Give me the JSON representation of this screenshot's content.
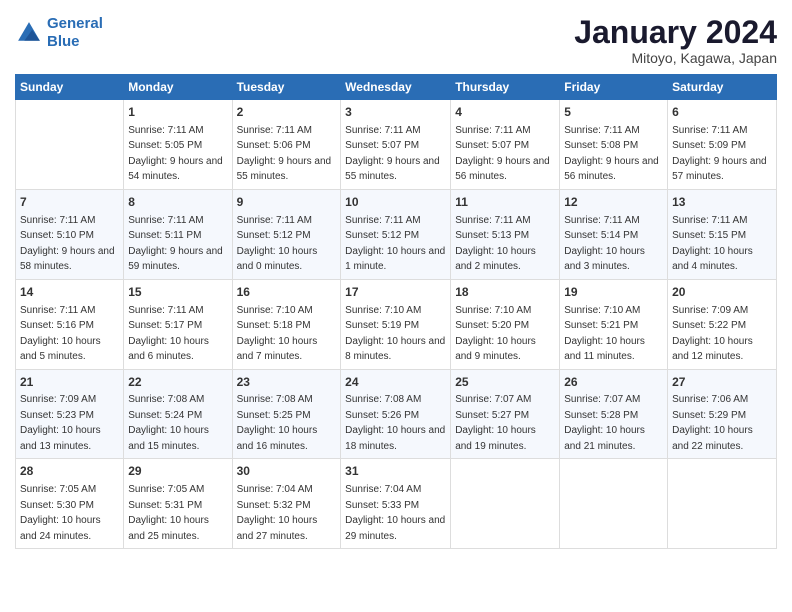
{
  "logo": {
    "line1": "General",
    "line2": "Blue"
  },
  "title": "January 2024",
  "location": "Mitoyo, Kagawa, Japan",
  "weekdays": [
    "Sunday",
    "Monday",
    "Tuesday",
    "Wednesday",
    "Thursday",
    "Friday",
    "Saturday"
  ],
  "weeks": [
    [
      {
        "day": "",
        "sunrise": "",
        "sunset": "",
        "daylight": ""
      },
      {
        "day": "1",
        "sunrise": "Sunrise: 7:11 AM",
        "sunset": "Sunset: 5:05 PM",
        "daylight": "Daylight: 9 hours and 54 minutes."
      },
      {
        "day": "2",
        "sunrise": "Sunrise: 7:11 AM",
        "sunset": "Sunset: 5:06 PM",
        "daylight": "Daylight: 9 hours and 55 minutes."
      },
      {
        "day": "3",
        "sunrise": "Sunrise: 7:11 AM",
        "sunset": "Sunset: 5:07 PM",
        "daylight": "Daylight: 9 hours and 55 minutes."
      },
      {
        "day": "4",
        "sunrise": "Sunrise: 7:11 AM",
        "sunset": "Sunset: 5:07 PM",
        "daylight": "Daylight: 9 hours and 56 minutes."
      },
      {
        "day": "5",
        "sunrise": "Sunrise: 7:11 AM",
        "sunset": "Sunset: 5:08 PM",
        "daylight": "Daylight: 9 hours and 56 minutes."
      },
      {
        "day": "6",
        "sunrise": "Sunrise: 7:11 AM",
        "sunset": "Sunset: 5:09 PM",
        "daylight": "Daylight: 9 hours and 57 minutes."
      }
    ],
    [
      {
        "day": "7",
        "sunrise": "Sunrise: 7:11 AM",
        "sunset": "Sunset: 5:10 PM",
        "daylight": "Daylight: 9 hours and 58 minutes."
      },
      {
        "day": "8",
        "sunrise": "Sunrise: 7:11 AM",
        "sunset": "Sunset: 5:11 PM",
        "daylight": "Daylight: 9 hours and 59 minutes."
      },
      {
        "day": "9",
        "sunrise": "Sunrise: 7:11 AM",
        "sunset": "Sunset: 5:12 PM",
        "daylight": "Daylight: 10 hours and 0 minutes."
      },
      {
        "day": "10",
        "sunrise": "Sunrise: 7:11 AM",
        "sunset": "Sunset: 5:12 PM",
        "daylight": "Daylight: 10 hours and 1 minute."
      },
      {
        "day": "11",
        "sunrise": "Sunrise: 7:11 AM",
        "sunset": "Sunset: 5:13 PM",
        "daylight": "Daylight: 10 hours and 2 minutes."
      },
      {
        "day": "12",
        "sunrise": "Sunrise: 7:11 AM",
        "sunset": "Sunset: 5:14 PM",
        "daylight": "Daylight: 10 hours and 3 minutes."
      },
      {
        "day": "13",
        "sunrise": "Sunrise: 7:11 AM",
        "sunset": "Sunset: 5:15 PM",
        "daylight": "Daylight: 10 hours and 4 minutes."
      }
    ],
    [
      {
        "day": "14",
        "sunrise": "Sunrise: 7:11 AM",
        "sunset": "Sunset: 5:16 PM",
        "daylight": "Daylight: 10 hours and 5 minutes."
      },
      {
        "day": "15",
        "sunrise": "Sunrise: 7:11 AM",
        "sunset": "Sunset: 5:17 PM",
        "daylight": "Daylight: 10 hours and 6 minutes."
      },
      {
        "day": "16",
        "sunrise": "Sunrise: 7:10 AM",
        "sunset": "Sunset: 5:18 PM",
        "daylight": "Daylight: 10 hours and 7 minutes."
      },
      {
        "day": "17",
        "sunrise": "Sunrise: 7:10 AM",
        "sunset": "Sunset: 5:19 PM",
        "daylight": "Daylight: 10 hours and 8 minutes."
      },
      {
        "day": "18",
        "sunrise": "Sunrise: 7:10 AM",
        "sunset": "Sunset: 5:20 PM",
        "daylight": "Daylight: 10 hours and 9 minutes."
      },
      {
        "day": "19",
        "sunrise": "Sunrise: 7:10 AM",
        "sunset": "Sunset: 5:21 PM",
        "daylight": "Daylight: 10 hours and 11 minutes."
      },
      {
        "day": "20",
        "sunrise": "Sunrise: 7:09 AM",
        "sunset": "Sunset: 5:22 PM",
        "daylight": "Daylight: 10 hours and 12 minutes."
      }
    ],
    [
      {
        "day": "21",
        "sunrise": "Sunrise: 7:09 AM",
        "sunset": "Sunset: 5:23 PM",
        "daylight": "Daylight: 10 hours and 13 minutes."
      },
      {
        "day": "22",
        "sunrise": "Sunrise: 7:08 AM",
        "sunset": "Sunset: 5:24 PM",
        "daylight": "Daylight: 10 hours and 15 minutes."
      },
      {
        "day": "23",
        "sunrise": "Sunrise: 7:08 AM",
        "sunset": "Sunset: 5:25 PM",
        "daylight": "Daylight: 10 hours and 16 minutes."
      },
      {
        "day": "24",
        "sunrise": "Sunrise: 7:08 AM",
        "sunset": "Sunset: 5:26 PM",
        "daylight": "Daylight: 10 hours and 18 minutes."
      },
      {
        "day": "25",
        "sunrise": "Sunrise: 7:07 AM",
        "sunset": "Sunset: 5:27 PM",
        "daylight": "Daylight: 10 hours and 19 minutes."
      },
      {
        "day": "26",
        "sunrise": "Sunrise: 7:07 AM",
        "sunset": "Sunset: 5:28 PM",
        "daylight": "Daylight: 10 hours and 21 minutes."
      },
      {
        "day": "27",
        "sunrise": "Sunrise: 7:06 AM",
        "sunset": "Sunset: 5:29 PM",
        "daylight": "Daylight: 10 hours and 22 minutes."
      }
    ],
    [
      {
        "day": "28",
        "sunrise": "Sunrise: 7:05 AM",
        "sunset": "Sunset: 5:30 PM",
        "daylight": "Daylight: 10 hours and 24 minutes."
      },
      {
        "day": "29",
        "sunrise": "Sunrise: 7:05 AM",
        "sunset": "Sunset: 5:31 PM",
        "daylight": "Daylight: 10 hours and 25 minutes."
      },
      {
        "day": "30",
        "sunrise": "Sunrise: 7:04 AM",
        "sunset": "Sunset: 5:32 PM",
        "daylight": "Daylight: 10 hours and 27 minutes."
      },
      {
        "day": "31",
        "sunrise": "Sunrise: 7:04 AM",
        "sunset": "Sunset: 5:33 PM",
        "daylight": "Daylight: 10 hours and 29 minutes."
      },
      {
        "day": "",
        "sunrise": "",
        "sunset": "",
        "daylight": ""
      },
      {
        "day": "",
        "sunrise": "",
        "sunset": "",
        "daylight": ""
      },
      {
        "day": "",
        "sunrise": "",
        "sunset": "",
        "daylight": ""
      }
    ]
  ]
}
